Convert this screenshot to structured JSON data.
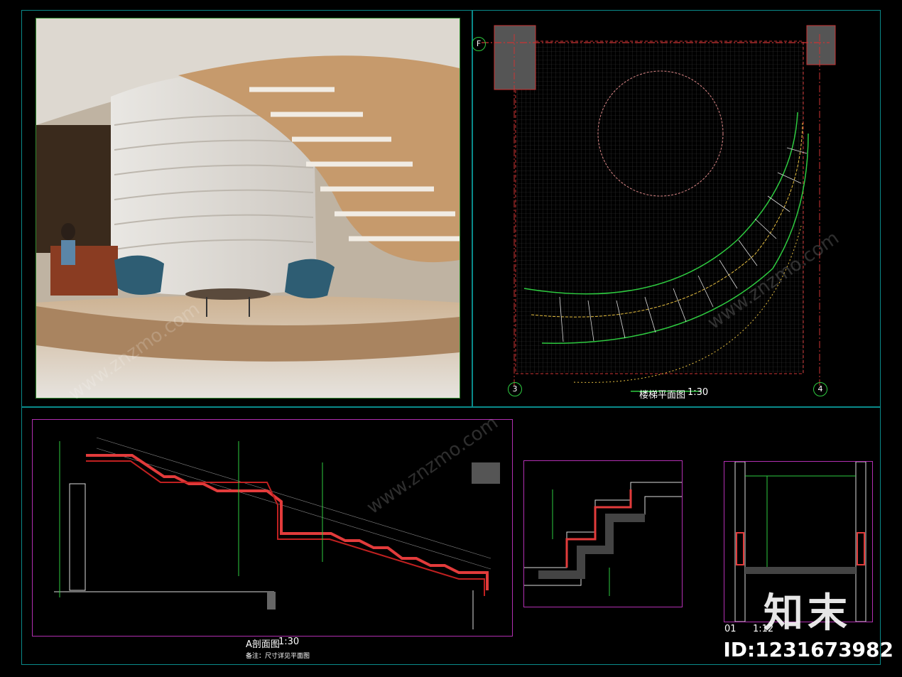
{
  "plan": {
    "title": "楼梯平面图",
    "scale": "1:30",
    "axes": [
      "F",
      "3",
      "4"
    ]
  },
  "section_a": {
    "title": "A剖面图",
    "scale": "1:30",
    "note": "备注：尺寸详见平面图"
  },
  "detail_b": {
    "title": "01",
    "scale": "1:12"
  },
  "id_label": "ID:1231673982",
  "logo_text": "知末",
  "watermark": "www.znzmo.com"
}
